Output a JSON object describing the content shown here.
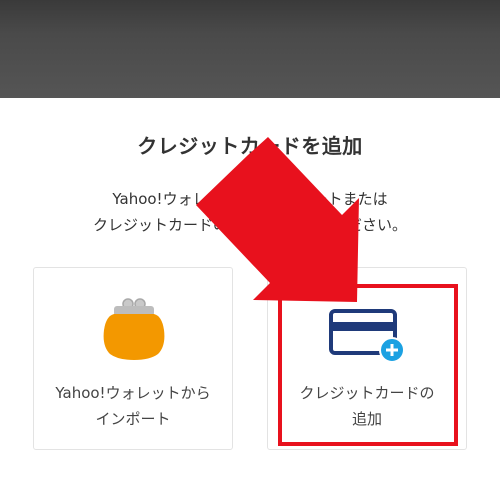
{
  "sheet": {
    "title": "クレジットカードを追加",
    "description_line1": "Yahoo!ウォレットからインポートまたは",
    "description_line2": "クレジットカードの追加を選択してください。"
  },
  "options": [
    {
      "icon": "coin-purse-icon",
      "label_line1": "Yahoo!ウォレットから",
      "label_line2": "インポート"
    },
    {
      "icon": "credit-card-add-icon",
      "label_line1": "クレジットカードの",
      "label_line2": "追加"
    }
  ],
  "colors": {
    "purse": "#F39800",
    "card_navy": "#1F3A7A",
    "plus_badge": "#1BA1E2",
    "annotation_red": "#E8111D"
  }
}
